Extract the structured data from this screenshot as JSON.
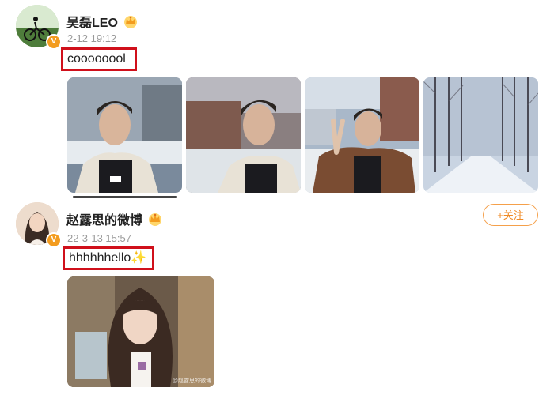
{
  "posts": [
    {
      "username": "吴磊LEO",
      "timestamp": "2-12 19:12",
      "content": "coooooool",
      "avatar_icon": "avatar-cyclist",
      "verified_badge": "V",
      "member_badge_icon": "crown-icon",
      "images": [
        "photo-portrait-1",
        "photo-portrait-2",
        "photo-peace-sign",
        "photo-snowy-street"
      ]
    },
    {
      "username": "赵露思的微博",
      "timestamp": "22-3-13 15:57",
      "content": "hhhhhhello",
      "content_emoji": "✨",
      "avatar_icon": "avatar-woman",
      "verified_badge": "V",
      "member_badge_icon": "crown-icon",
      "follow_label": "+关注",
      "images": [
        "photo-selfie"
      ],
      "watermark": "@赵露思的微博"
    }
  ],
  "colors": {
    "highlight_border": "#d0101b",
    "follow_accent": "#f08a24",
    "verify_badge": "#f39c1f",
    "timestamp_gray": "#999999"
  }
}
